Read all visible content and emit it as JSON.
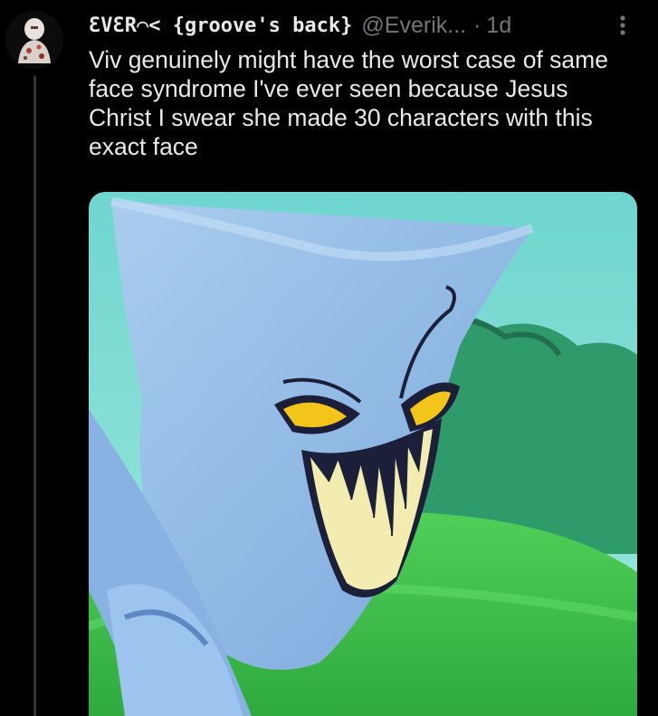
{
  "tweet": {
    "display_name": "ƐVƐR⌒< {groove's back}",
    "handle": "@Everik...",
    "separator": "·",
    "time": "1d",
    "text": "Viv genuinely might have the worst case of same face syndrome I've ever seen because Jesus Christ I swear she made 30 characters with this exact face",
    "more_icon": "vertical-ellipsis-icon",
    "avatar_icon": "user-avatar"
  },
  "colors": {
    "background": "#000000",
    "text": "#e7e9ea",
    "secondary": "#71767b",
    "thread_line": "#333639"
  }
}
